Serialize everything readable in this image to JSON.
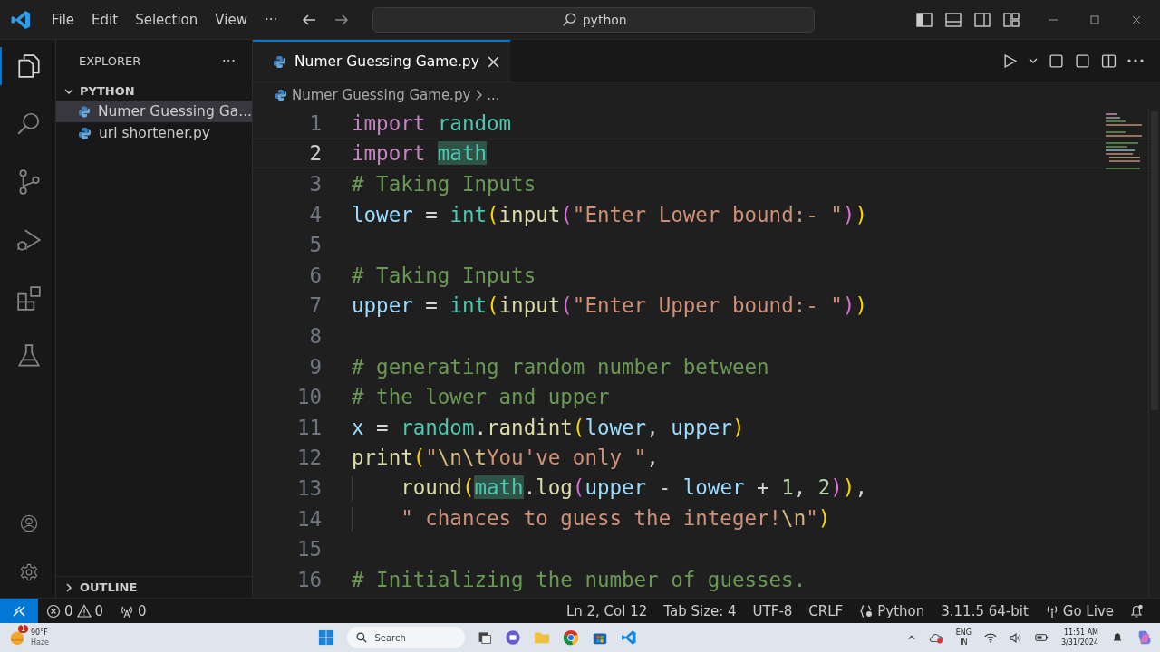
{
  "title_bar": {
    "menu": [
      "File",
      "Edit",
      "Selection",
      "View",
      "···"
    ],
    "search": "python"
  },
  "activity_bar": [
    {
      "kind": "files",
      "selected": true
    },
    {
      "kind": "search",
      "selected": false
    },
    {
      "kind": "source-control",
      "selected": false
    },
    {
      "kind": "run-debug",
      "selected": false
    },
    {
      "kind": "extensions",
      "selected": false
    },
    {
      "kind": "testing",
      "selected": false
    }
  ],
  "sidebar": {
    "title": "EXPLORER",
    "more": "···",
    "folder": {
      "label": "PYTHON",
      "expanded": true,
      "children": [
        {
          "label": "Numer Guessing Ga...",
          "selected": true
        },
        {
          "label": "url shortener.py",
          "selected": false
        }
      ]
    },
    "outline": {
      "label": "OUTLINE",
      "expanded": false
    }
  },
  "editor": {
    "tab": {
      "label": "Numer Guessing Game.py",
      "selected": true
    },
    "breadcrumb": [
      "Numer Guessing Game.py",
      "..."
    ],
    "lines": [
      {
        "number": "1",
        "current": false,
        "tokens": [
          {
            "kind": "keyword",
            "text": "import "
          },
          {
            "kind": "module",
            "text": "random"
          }
        ]
      },
      {
        "number": "2",
        "current": true,
        "tokens": [
          {
            "kind": "keyword",
            "text": "import "
          },
          {
            "kind": "module",
            "text": "math",
            "highlight": true
          }
        ]
      },
      {
        "number": "3",
        "current": false,
        "tokens": [
          {
            "kind": "comment",
            "text": "# Taking Inputs"
          }
        ]
      },
      {
        "number": "4",
        "current": false,
        "tokens": [
          {
            "kind": "variable",
            "text": "lower"
          },
          {
            "kind": "plain",
            "text": " = "
          },
          {
            "kind": "module",
            "text": "int"
          },
          {
            "kind": "bracket1",
            "text": "("
          },
          {
            "kind": "function",
            "text": "input"
          },
          {
            "kind": "bracket2",
            "text": "("
          },
          {
            "kind": "string",
            "text": "\"Enter Lower bound:- \""
          },
          {
            "kind": "bracket2",
            "text": ")"
          },
          {
            "kind": "bracket1",
            "text": ")"
          }
        ]
      },
      {
        "number": "5",
        "current": false
      },
      {
        "number": "6",
        "current": false,
        "tokens": [
          {
            "kind": "comment",
            "text": "# Taking Inputs"
          }
        ]
      },
      {
        "number": "7",
        "current": false,
        "tokens": [
          {
            "kind": "variable",
            "text": "upper"
          },
          {
            "kind": "plain",
            "text": " = "
          },
          {
            "kind": "module",
            "text": "int"
          },
          {
            "kind": "bracket1",
            "text": "("
          },
          {
            "kind": "function",
            "text": "input"
          },
          {
            "kind": "bracket2",
            "text": "("
          },
          {
            "kind": "string",
            "text": "\"Enter Upper bound:- \""
          },
          {
            "kind": "bracket2",
            "text": ")"
          },
          {
            "kind": "bracket1",
            "text": ")"
          }
        ]
      },
      {
        "number": "8",
        "current": false
      },
      {
        "number": "9",
        "current": false,
        "tokens": [
          {
            "kind": "comment",
            "text": "# generating random number between"
          }
        ]
      },
      {
        "number": "10",
        "current": false,
        "tokens": [
          {
            "kind": "comment",
            "text": "# the lower and upper"
          }
        ]
      },
      {
        "number": "11",
        "current": false,
        "tokens": [
          {
            "kind": "variable",
            "text": "x"
          },
          {
            "kind": "plain",
            "text": " = "
          },
          {
            "kind": "module",
            "text": "random"
          },
          {
            "kind": "plain",
            "text": "."
          },
          {
            "kind": "function",
            "text": "randint"
          },
          {
            "kind": "bracket1",
            "text": "("
          },
          {
            "kind": "variable",
            "text": "lower"
          },
          {
            "kind": "plain",
            "text": ", "
          },
          {
            "kind": "variable",
            "text": "upper"
          },
          {
            "kind": "bracket1",
            "text": ")"
          }
        ]
      },
      {
        "number": "12",
        "current": false,
        "tokens": [
          {
            "kind": "function",
            "text": "print"
          },
          {
            "kind": "bracket1",
            "text": "("
          },
          {
            "kind": "string",
            "text": "\""
          },
          {
            "kind": "escape",
            "text": "\\n\\t"
          },
          {
            "kind": "string",
            "text": "You've only \""
          },
          {
            "kind": "plain",
            "text": ","
          }
        ]
      },
      {
        "number": "13",
        "current": false,
        "indented": true,
        "tokens": [
          {
            "kind": "function",
            "text": "round"
          },
          {
            "kind": "bracket1",
            "text": "("
          },
          {
            "kind": "module",
            "text": "math",
            "highlight": true
          },
          {
            "kind": "plain",
            "text": "."
          },
          {
            "kind": "function",
            "text": "log"
          },
          {
            "kind": "bracket2",
            "text": "("
          },
          {
            "kind": "variable",
            "text": "upper"
          },
          {
            "kind": "plain",
            "text": " - "
          },
          {
            "kind": "variable",
            "text": "lower"
          },
          {
            "kind": "plain",
            "text": " + "
          },
          {
            "kind": "number",
            "text": "1"
          },
          {
            "kind": "plain",
            "text": ", "
          },
          {
            "kind": "number",
            "text": "2"
          },
          {
            "kind": "bracket2",
            "text": ")"
          },
          {
            "kind": "bracket1",
            "text": ")"
          },
          {
            "kind": "plain",
            "text": ","
          }
        ]
      },
      {
        "number": "14",
        "current": false,
        "indented": true,
        "tokens": [
          {
            "kind": "string",
            "text": "\" chances to guess the integer!"
          },
          {
            "kind": "escape",
            "text": "\\n"
          },
          {
            "kind": "string",
            "text": "\""
          },
          {
            "kind": "bracket1",
            "text": ")"
          }
        ]
      },
      {
        "number": "15",
        "current": false
      },
      {
        "number": "16",
        "current": false,
        "tokens": [
          {
            "kind": "comment",
            "text": "# Initializing the number of guesses."
          }
        ]
      }
    ]
  },
  "status_bar": {
    "errors": "0",
    "warnings": "0",
    "ports": "0",
    "items": [
      {
        "text": "Ln 2, Col 12"
      },
      {
        "text": "Tab Size: 4"
      },
      {
        "text": "UTF-8"
      },
      {
        "text": "CRLF"
      },
      {
        "text": "Python",
        "kind": "language"
      },
      {
        "text": "3.11.5 64-bit"
      },
      {
        "text": "Go Live",
        "kind": "live-server"
      }
    ]
  },
  "taskbar": {
    "weather": {
      "badge": "1",
      "temperature": "90°F",
      "condition": "Haze"
    },
    "search": "Search",
    "language": [
      "ENG",
      "IN"
    ],
    "time": "11:51 AM",
    "date": "3/31/2024"
  }
}
